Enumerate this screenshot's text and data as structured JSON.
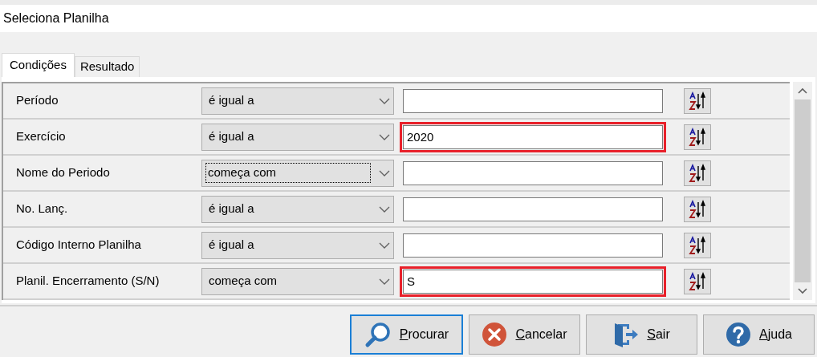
{
  "window": {
    "title": "Seleciona Planilha"
  },
  "tabs": [
    {
      "label": "Condições",
      "selected": true
    },
    {
      "label": "Resultado",
      "selected": false
    }
  ],
  "conditions": [
    {
      "field": "Período",
      "operator": "é igual a",
      "operator_focused": false,
      "highlighted": false
    },
    {
      "field": "Exercício",
      "operator": "é igual a",
      "operator_focused": false,
      "value": "2020",
      "highlighted": true
    },
    {
      "field": "Nome do Periodo",
      "operator": "começa com",
      "operator_focused": true,
      "highlighted": false
    },
    {
      "field": "No. Lanç.",
      "operator": "é igual a",
      "operator_focused": false,
      "highlighted": false
    },
    {
      "field": "Código Interno Planilha",
      "operator": "é igual a",
      "operator_focused": false,
      "highlighted": false
    },
    {
      "field": "Planil. Encerramento (S/N)",
      "operator": "começa com",
      "operator_focused": false,
      "value": "S",
      "highlighted": true
    }
  ],
  "buttons": [
    {
      "kind": "search",
      "label": "Procurar",
      "default": true
    },
    {
      "kind": "cancel",
      "label": "Cancelar",
      "default": false
    },
    {
      "kind": "exit",
      "label": "Sair",
      "default": false
    },
    {
      "kind": "help",
      "label": "Ajuda",
      "default": false
    }
  ]
}
